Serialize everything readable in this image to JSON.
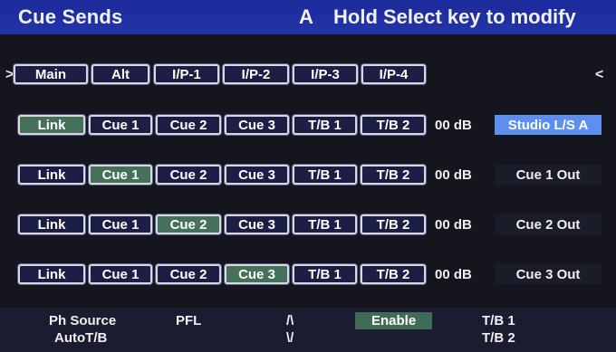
{
  "header": {
    "title": "Cue Sends",
    "page": "A",
    "hint": "Hold Select key to modify"
  },
  "nav": {
    "left_arrow": ">",
    "right_arrow": "<"
  },
  "tabs": [
    "Main",
    "Alt",
    "I/P-1",
    "I/P-2",
    "I/P-3",
    "I/P-4"
  ],
  "rows": [
    {
      "buttons": [
        "Link",
        "Cue 1",
        "Cue 2",
        "Cue 3",
        "T/B 1",
        "T/B 2"
      ],
      "active": "Link",
      "level": "00 dB",
      "destination": "Studio L/S A",
      "selected": true
    },
    {
      "buttons": [
        "Link",
        "Cue 1",
        "Cue 2",
        "Cue 3",
        "T/B 1",
        "T/B 2"
      ],
      "active": "Cue 1",
      "level": "00 dB",
      "destination": "Cue 1 Out",
      "selected": false
    },
    {
      "buttons": [
        "Link",
        "Cue 1",
        "Cue 2",
        "Cue 3",
        "T/B 1",
        "T/B 2"
      ],
      "active": "Cue 2",
      "level": "00 dB",
      "destination": "Cue 2 Out",
      "selected": false
    },
    {
      "buttons": [
        "Link",
        "Cue 1",
        "Cue 2",
        "Cue 3",
        "T/B 1",
        "T/B 2"
      ],
      "active": "Cue 3",
      "level": "00 dB",
      "destination": "Cue 3 Out",
      "selected": false
    }
  ],
  "footer": {
    "ph_source": "Ph Source",
    "auto_tb": "AutoT/B",
    "pfl": "PFL",
    "up": "/\\",
    "down": "\\/",
    "enable": "Enable",
    "tb1": "T/B 1",
    "tb2": "T/B 2"
  },
  "colors": {
    "header_bg": "#2535a8",
    "button_active": "#45715a",
    "destination_selected": "#5c8ff0",
    "enable_bg": "#406b57"
  }
}
